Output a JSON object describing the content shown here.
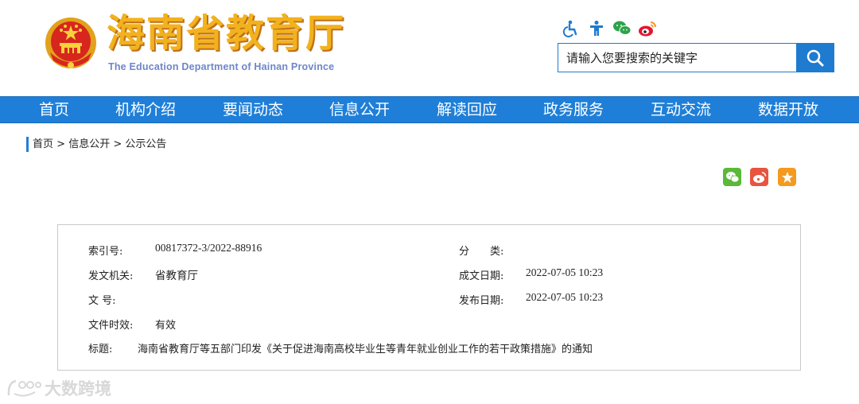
{
  "header": {
    "site_title": "海南省教育厅",
    "site_subtitle": "The Education Department of Hainan Province",
    "tools": [
      "accessibility-icon",
      "elder-mode-icon",
      "wechat-icon",
      "weibo-icon"
    ]
  },
  "search": {
    "placeholder": "请输入您要搜索的关键字",
    "button_icon": "search-icon"
  },
  "nav": {
    "items": [
      {
        "label": "首页"
      },
      {
        "label": "机构介绍"
      },
      {
        "label": "要闻动态"
      },
      {
        "label": "信息公开"
      },
      {
        "label": "解读回应"
      },
      {
        "label": "政务服务"
      },
      {
        "label": "互动交流"
      },
      {
        "label": "数据开放"
      }
    ]
  },
  "breadcrumb": {
    "items": [
      "首页",
      "信息公开",
      "公示公告"
    ],
    "separator": ">"
  },
  "share": {
    "icons": [
      "wechat-share-icon",
      "weibo-share-icon",
      "favorite-icon"
    ],
    "colors": {
      "wechat": "#5ab936",
      "weibo": "#e8543f",
      "favorite": "#f39a1f"
    }
  },
  "meta": {
    "index_label": "索引号:",
    "index_value": "00817372-3/2022-88916",
    "category_label": "分　　类:",
    "category_value": "",
    "issuer_label": "发文机关:",
    "issuer_value": "省教育厅",
    "created_label": "成文日期:",
    "created_value": "2022-07-05 10:23",
    "docno_label": "文  号:",
    "docno_value": "",
    "published_label": "发布日期:",
    "published_value": "2022-07-05 10:23",
    "validity_label": "文件时效:",
    "validity_value": "有效",
    "title_label": "标题:",
    "title_value": "海南省教育厅等五部门印发《关于促进海南高校毕业生等青年就业创业工作的若干政策措施》的通知"
  },
  "watermark": {
    "text": "大数跨境"
  },
  "colors": {
    "nav_blue": "#1f7fd8",
    "logo_gold": "#f2b21d",
    "subtitle_blue": "#6e86c8"
  }
}
